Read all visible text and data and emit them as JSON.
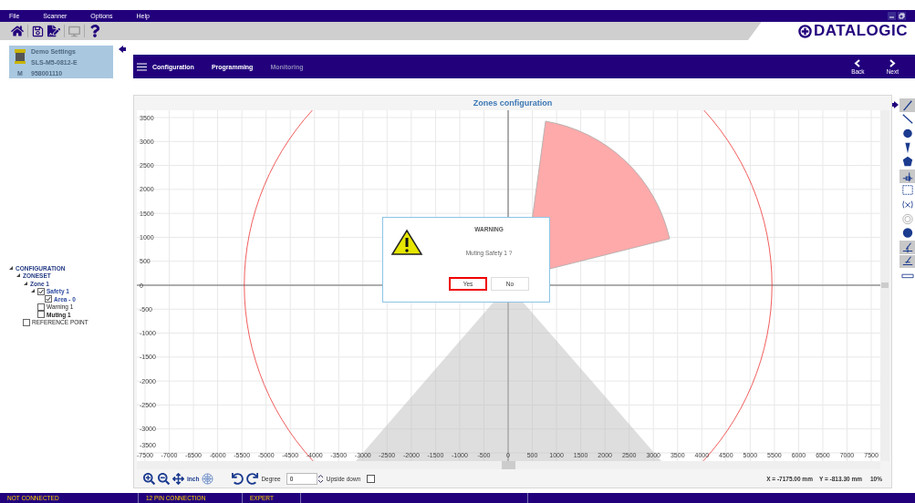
{
  "menu": [
    "File",
    "Scanner",
    "Options",
    "Help"
  ],
  "logo": "DATALOGIC",
  "device": {
    "name": "Demo Settings",
    "model": "SLS-M5-0812-E",
    "m_label": "M",
    "serial": "958001110"
  },
  "nav": {
    "tabs": [
      {
        "label": "Configuration",
        "disabled": false
      },
      {
        "label": "Programming",
        "disabled": false
      },
      {
        "label": "Monitoring",
        "disabled": true
      }
    ],
    "back": "Back",
    "next": "Next"
  },
  "tree": [
    {
      "label": "CONFIGURATION",
      "kind": "folder",
      "expanded": true,
      "children": [
        {
          "label": "ZONESET",
          "kind": "folder",
          "expanded": true,
          "children": [
            {
              "label": "Zone 1",
              "kind": "folder",
              "expanded": true,
              "children": [
                {
                  "label": "Safety 1",
                  "kind": "check",
                  "checked": true,
                  "selected": false,
                  "expanded": true,
                  "children": [
                    {
                      "label": "Area - 0",
                      "kind": "check",
                      "checked": true,
                      "selected": false
                    }
                  ]
                },
                {
                  "label": "Warning 1",
                  "kind": "check",
                  "checked": false,
                  "selected": false
                },
                {
                  "label": "Muting 1",
                  "kind": "check",
                  "checked": false,
                  "selected": true
                }
              ]
            }
          ]
        },
        {
          "label": "REFERENCE POINT",
          "kind": "check",
          "checked": false,
          "selected": false
        }
      ]
    }
  ],
  "plot": {
    "title": "Zones configuration",
    "y_ticks": [
      "3500",
      "3000",
      "2500",
      "2000",
      "1500",
      "1000",
      "500",
      "0",
      "-500",
      "-1000",
      "-1500",
      "-2000",
      "-2500",
      "-3000",
      "-3500"
    ],
    "x_ticks": [
      "-7500",
      "-7000",
      "-6500",
      "-6000",
      "-5500",
      "-5000",
      "-4500",
      "-4000",
      "-3500",
      "-3000",
      "-2500",
      "-2000",
      "-1500",
      "-1000",
      "-500",
      "0",
      "500",
      "1000",
      "1500",
      "2000",
      "2500",
      "3000",
      "3500",
      "4000",
      "4500",
      "5000",
      "5500",
      "6000",
      "6500",
      "7000",
      "7500"
    ]
  },
  "dialog": {
    "title": "WARNING",
    "message": "Muting Safety 1 ?",
    "buttons": [
      {
        "label": "Yes",
        "focused": true
      },
      {
        "label": "No",
        "focused": false
      }
    ]
  },
  "bottom": {
    "unit": "inch",
    "degree_label": "Degree",
    "degree_value": "0",
    "upside_down": {
      "label": "Upside down",
      "checked": false
    },
    "x_reading": "X = -7175.00 mm",
    "y_reading": "Y = -813.30 mm",
    "zoom": "10%"
  },
  "status": [
    "NOT CONNECTED",
    "12 PIN CONNECTION",
    "EXPERT"
  ]
}
